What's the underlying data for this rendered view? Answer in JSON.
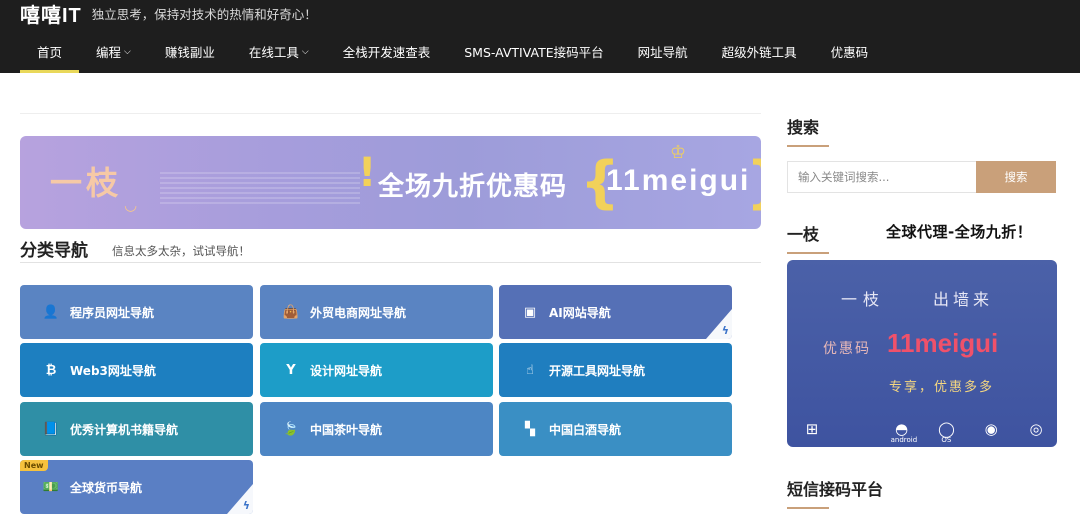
{
  "site": {
    "logo": "嘻嘻IT",
    "slogan": "独立思考，保持对技术的热情和好奇心！"
  },
  "nav": {
    "items": [
      {
        "label": "首页",
        "dropdown": false
      },
      {
        "label": "编程",
        "dropdown": true
      },
      {
        "label": "赚钱副业",
        "dropdown": false
      },
      {
        "label": "在线工具",
        "dropdown": true
      },
      {
        "label": "全栈开发速查表",
        "dropdown": false
      },
      {
        "label": "SMS-AVTIVATE接码平台",
        "dropdown": false
      },
      {
        "label": "网址导航",
        "dropdown": false
      },
      {
        "label": "超级外链工具",
        "dropdown": false
      },
      {
        "label": "优惠码",
        "dropdown": false
      }
    ],
    "active_index": 0,
    "caret": "⌵"
  },
  "banner": {
    "left_text": "一枝",
    "headline": "全场九折优惠码",
    "code": "11meigui"
  },
  "category": {
    "title": "分类导航",
    "subtitle": "信息太多太杂，试试导航！",
    "cards": [
      {
        "label": "程序员网址导航",
        "icon": "user-icon",
        "glyph": "👤",
        "color": "#5a84c2",
        "corner": false,
        "badge": ""
      },
      {
        "label": "外贸电商网址导航",
        "icon": "shopping-bag-icon",
        "glyph": "👜",
        "color": "#5a84c2",
        "corner": false,
        "badge": ""
      },
      {
        "label": "AI网站导航",
        "icon": "image-icon",
        "glyph": "▣",
        "color": "#5570b6",
        "corner": true,
        "badge": ""
      },
      {
        "label": "Web3网址导航",
        "icon": "bitcoin-icon",
        "glyph": "₿",
        "color": "#1d7fc0",
        "corner": false,
        "badge": ""
      },
      {
        "label": "设计网址导航",
        "icon": "y-square-icon",
        "glyph": "Y",
        "color": "#1d9dc8",
        "corner": false,
        "badge": ""
      },
      {
        "label": "开源工具网址导航",
        "icon": "hand-point-icon",
        "glyph": "☝",
        "color": "#1f7ebf",
        "corner": false,
        "badge": ""
      },
      {
        "label": "优秀计算机书籍导航",
        "icon": "book-icon",
        "glyph": "📘",
        "color": "#2f8fa6",
        "corner": false,
        "badge": ""
      },
      {
        "label": "中国茶叶导航",
        "icon": "leaf-icon",
        "glyph": "🍃",
        "color": "#4d86c4",
        "corner": false,
        "badge": ""
      },
      {
        "label": "中国白酒导航",
        "icon": "bottle-icon",
        "glyph": "▚",
        "color": "#3a8fc4",
        "corner": false,
        "badge": ""
      },
      {
        "label": "全球货币导航",
        "icon": "money-bill-icon",
        "glyph": "💵",
        "color": "#5a7fc4",
        "corner": true,
        "badge": "New"
      }
    ]
  },
  "sidebar": {
    "search_title": "搜索",
    "search_placeholder": "输入关键词搜索...",
    "search_button": "搜索",
    "promo_title": "一枝",
    "promo_text": "全球代理-全场九折！",
    "ad": {
      "line1a": "一枝",
      "line1b": "出墙来",
      "line2a": "优惠码",
      "line2b": "11meigui",
      "line3": "专享，优惠多多",
      "platforms": [
        "windows-icon",
        "apple-icon",
        "android-icon",
        "macos-icon",
        "firefox-icon",
        "chrome-icon"
      ],
      "android_caption": "android",
      "macos_caption": "OS"
    },
    "sms_title": "短信接码平台"
  }
}
